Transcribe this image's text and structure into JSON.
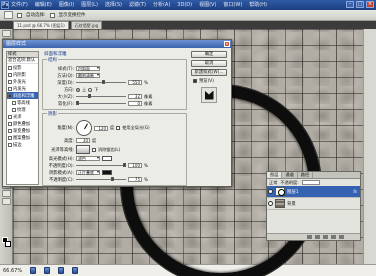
{
  "app": {
    "logo": "Ps"
  },
  "menu": [
    "文件(F)",
    "编辑(E)",
    "图像(I)",
    "图层(L)",
    "选择(S)",
    "滤镜(T)",
    "分析(A)",
    "3D(D)",
    "视图(V)",
    "窗口(W)",
    "帮助(H)"
  ],
  "window_controls": {
    "minimize": "–",
    "maximize": "□",
    "close": "×"
  },
  "options_bar": {
    "label1": "自动选择:",
    "label2": "显示变换控件"
  },
  "doc_tabs": [
    {
      "label": "11.psd @ 66.7% (图层1)"
    },
    {
      "label": "石纹墙壁.jpg"
    }
  ],
  "dialog": {
    "title": "图层样式",
    "close": "×",
    "styles_header": "样式",
    "blend_options": "混合选项:默认",
    "styles": [
      {
        "label": "投影",
        "checked": false
      },
      {
        "label": "内阴影",
        "checked": false
      },
      {
        "label": "外发光",
        "checked": false
      },
      {
        "label": "内发光",
        "checked": false
      },
      {
        "label": "斜面和浮雕",
        "checked": true,
        "selected": true
      },
      {
        "label": "等高线",
        "checked": false,
        "sub": true
      },
      {
        "label": "纹理",
        "checked": false,
        "sub": true
      },
      {
        "label": "光泽",
        "checked": false
      },
      {
        "label": "颜色叠加",
        "checked": false
      },
      {
        "label": "渐变叠加",
        "checked": false
      },
      {
        "label": "图案叠加",
        "checked": false
      },
      {
        "label": "描边",
        "checked": false
      }
    ],
    "bevel_section_title": "斜面和浮雕",
    "structure_label": "结构",
    "style_label": "样式(T):",
    "style_value": "内斜面",
    "technique_label": "方法(Q):",
    "technique_value": "雕刻清晰",
    "depth_label": "深度(D):",
    "depth_value": "550",
    "depth_unit": "%",
    "depth_fraction": 0.55,
    "direction_label": "方向:",
    "direction_up": "上",
    "direction_down": "下",
    "size_label": "大小(Z):",
    "size_value": "32",
    "size_unit": "像素",
    "size_fraction": 0.25,
    "soften_label": "软化(F):",
    "soften_value": "0",
    "soften_unit": "像素",
    "soften_fraction": 0.0,
    "shading_label": "阴影",
    "angle_label": "角度(N):",
    "angle_value": "120",
    "angle_unit": "度",
    "global_light_label": "使用全局光(G)",
    "altitude_label": "高度:",
    "altitude_value": "30",
    "altitude_unit": "度",
    "gloss_label": "光泽等高线:",
    "antialias_label": "消除锯齿(L)",
    "highlight_mode_label": "高光模式(H):",
    "highlight_mode_value": "滤色",
    "highlight_opacity_label": "不透明度(O):",
    "highlight_opacity_value": "100",
    "highlight_opacity_fraction": 1.0,
    "shadow_mode_label": "阴影模式(A):",
    "shadow_mode_value": "正片叠底",
    "shadow_opacity_label": "不透明度(C):",
    "shadow_opacity_value": "75",
    "shadow_opacity_fraction": 0.75,
    "percent": "%",
    "highlight_color": "#ffffff",
    "shadow_color": "#111111",
    "buttons": {
      "ok": "确定",
      "cancel": "取消",
      "new_style": "新建样式(W)...",
      "preview": "预览(V)"
    }
  },
  "layers_panel": {
    "tabs": [
      "图层",
      "通道",
      "路径"
    ],
    "blend_label": "正常",
    "opacity_label": "不透明度:",
    "layers": [
      {
        "name": "图层1",
        "selected": true,
        "fx": "fx"
      },
      {
        "name": "背景",
        "selected": false,
        "fx": ""
      }
    ]
  },
  "status": {
    "zoom": "66.67%"
  },
  "colors": {
    "title_bar": "#2f5aa6",
    "selection": "#3563b2",
    "ring": "#0d0d0d"
  }
}
